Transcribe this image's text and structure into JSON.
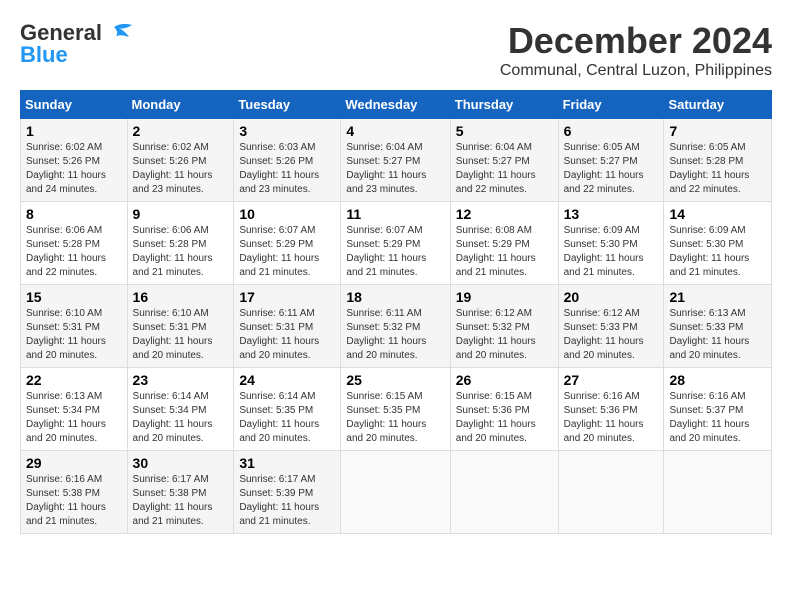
{
  "logo": {
    "general": "General",
    "blue": "Blue"
  },
  "title": {
    "month": "December 2024",
    "location": "Communal, Central Luzon, Philippines"
  },
  "weekdays": [
    "Sunday",
    "Monday",
    "Tuesday",
    "Wednesday",
    "Thursday",
    "Friday",
    "Saturday"
  ],
  "weeks": [
    [
      {
        "day": "1",
        "info": "Sunrise: 6:02 AM\nSunset: 5:26 PM\nDaylight: 11 hours\nand 24 minutes."
      },
      {
        "day": "2",
        "info": "Sunrise: 6:02 AM\nSunset: 5:26 PM\nDaylight: 11 hours\nand 23 minutes."
      },
      {
        "day": "3",
        "info": "Sunrise: 6:03 AM\nSunset: 5:26 PM\nDaylight: 11 hours\nand 23 minutes."
      },
      {
        "day": "4",
        "info": "Sunrise: 6:04 AM\nSunset: 5:27 PM\nDaylight: 11 hours\nand 23 minutes."
      },
      {
        "day": "5",
        "info": "Sunrise: 6:04 AM\nSunset: 5:27 PM\nDaylight: 11 hours\nand 22 minutes."
      },
      {
        "day": "6",
        "info": "Sunrise: 6:05 AM\nSunset: 5:27 PM\nDaylight: 11 hours\nand 22 minutes."
      },
      {
        "day": "7",
        "info": "Sunrise: 6:05 AM\nSunset: 5:28 PM\nDaylight: 11 hours\nand 22 minutes."
      }
    ],
    [
      {
        "day": "8",
        "info": "Sunrise: 6:06 AM\nSunset: 5:28 PM\nDaylight: 11 hours\nand 22 minutes."
      },
      {
        "day": "9",
        "info": "Sunrise: 6:06 AM\nSunset: 5:28 PM\nDaylight: 11 hours\nand 21 minutes."
      },
      {
        "day": "10",
        "info": "Sunrise: 6:07 AM\nSunset: 5:29 PM\nDaylight: 11 hours\nand 21 minutes."
      },
      {
        "day": "11",
        "info": "Sunrise: 6:07 AM\nSunset: 5:29 PM\nDaylight: 11 hours\nand 21 minutes."
      },
      {
        "day": "12",
        "info": "Sunrise: 6:08 AM\nSunset: 5:29 PM\nDaylight: 11 hours\nand 21 minutes."
      },
      {
        "day": "13",
        "info": "Sunrise: 6:09 AM\nSunset: 5:30 PM\nDaylight: 11 hours\nand 21 minutes."
      },
      {
        "day": "14",
        "info": "Sunrise: 6:09 AM\nSunset: 5:30 PM\nDaylight: 11 hours\nand 21 minutes."
      }
    ],
    [
      {
        "day": "15",
        "info": "Sunrise: 6:10 AM\nSunset: 5:31 PM\nDaylight: 11 hours\nand 20 minutes."
      },
      {
        "day": "16",
        "info": "Sunrise: 6:10 AM\nSunset: 5:31 PM\nDaylight: 11 hours\nand 20 minutes."
      },
      {
        "day": "17",
        "info": "Sunrise: 6:11 AM\nSunset: 5:31 PM\nDaylight: 11 hours\nand 20 minutes."
      },
      {
        "day": "18",
        "info": "Sunrise: 6:11 AM\nSunset: 5:32 PM\nDaylight: 11 hours\nand 20 minutes."
      },
      {
        "day": "19",
        "info": "Sunrise: 6:12 AM\nSunset: 5:32 PM\nDaylight: 11 hours\nand 20 minutes."
      },
      {
        "day": "20",
        "info": "Sunrise: 6:12 AM\nSunset: 5:33 PM\nDaylight: 11 hours\nand 20 minutes."
      },
      {
        "day": "21",
        "info": "Sunrise: 6:13 AM\nSunset: 5:33 PM\nDaylight: 11 hours\nand 20 minutes."
      }
    ],
    [
      {
        "day": "22",
        "info": "Sunrise: 6:13 AM\nSunset: 5:34 PM\nDaylight: 11 hours\nand 20 minutes."
      },
      {
        "day": "23",
        "info": "Sunrise: 6:14 AM\nSunset: 5:34 PM\nDaylight: 11 hours\nand 20 minutes."
      },
      {
        "day": "24",
        "info": "Sunrise: 6:14 AM\nSunset: 5:35 PM\nDaylight: 11 hours\nand 20 minutes."
      },
      {
        "day": "25",
        "info": "Sunrise: 6:15 AM\nSunset: 5:35 PM\nDaylight: 11 hours\nand 20 minutes."
      },
      {
        "day": "26",
        "info": "Sunrise: 6:15 AM\nSunset: 5:36 PM\nDaylight: 11 hours\nand 20 minutes."
      },
      {
        "day": "27",
        "info": "Sunrise: 6:16 AM\nSunset: 5:36 PM\nDaylight: 11 hours\nand 20 minutes."
      },
      {
        "day": "28",
        "info": "Sunrise: 6:16 AM\nSunset: 5:37 PM\nDaylight: 11 hours\nand 20 minutes."
      }
    ],
    [
      {
        "day": "29",
        "info": "Sunrise: 6:16 AM\nSunset: 5:38 PM\nDaylight: 11 hours\nand 21 minutes."
      },
      {
        "day": "30",
        "info": "Sunrise: 6:17 AM\nSunset: 5:38 PM\nDaylight: 11 hours\nand 21 minutes."
      },
      {
        "day": "31",
        "info": "Sunrise: 6:17 AM\nSunset: 5:39 PM\nDaylight: 11 hours\nand 21 minutes."
      },
      null,
      null,
      null,
      null
    ]
  ]
}
